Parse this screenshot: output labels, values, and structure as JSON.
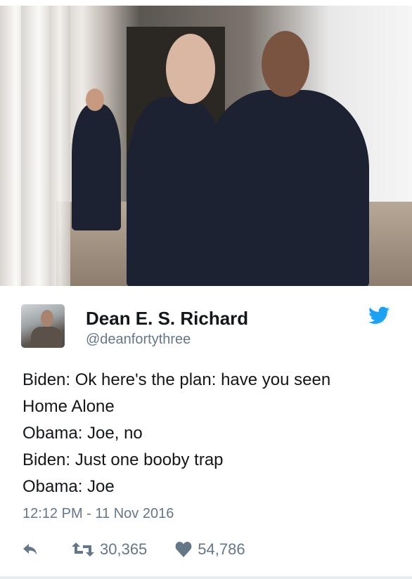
{
  "tweet": {
    "author_name": "Dean E. S. Richard",
    "handle": "@deanfortythree",
    "lines": [
      "Biden: Ok here's the plan: have you seen",
      "Home Alone",
      "Obama: Joe, no",
      "Biden: Just one booby trap",
      "Obama: Joe"
    ],
    "timestamp": "12:12 PM - 11 Nov 2016",
    "retweets": "30,365",
    "likes": "54,786"
  },
  "icons": {
    "brand": "twitter-bird-icon",
    "reply": "reply-icon",
    "retweet": "retweet-icon",
    "like": "heart-icon"
  },
  "colors": {
    "brand": "#1da1f2",
    "secondary_text": "#657786",
    "primary_text": "#14171a"
  }
}
